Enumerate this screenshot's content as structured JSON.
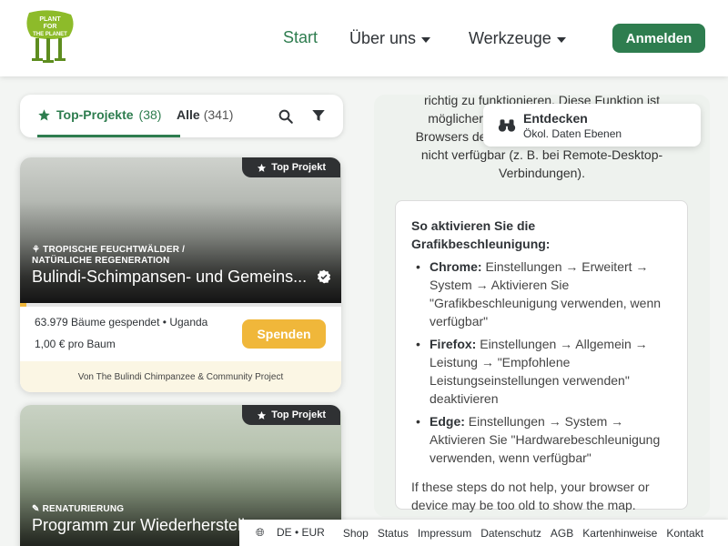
{
  "header": {
    "logo_alt": "PLANT FOR THE PLANET",
    "nav": {
      "start": "Start",
      "about": "Über uns",
      "tools": "Werkzeuge"
    },
    "login_label": "Anmelden",
    "accent": "#2e7d4f"
  },
  "tabs": {
    "top_label": "Top-Projekte",
    "top_count": "(38)",
    "all_label": "Alle",
    "all_count": "(341)"
  },
  "projects": [
    {
      "badge": "Top Projekt",
      "category": "Tropische Feuchtwälder / natürliche Regeneration",
      "title": "Bulindi-Schimpansen- und Gemeins...",
      "stats": "63.979 Bäume gespendet • Uganda",
      "price": "1,00 € pro Baum",
      "donate_label": "Spenden",
      "by": "Von The Bulindi Chimpanzee & Community Project",
      "progress_percent": 2
    },
    {
      "badge": "Top Projekt",
      "category": "Renaturierung",
      "title": "Programm zur Wiederherstellung"
    }
  ],
  "map": {
    "intro_text": "richtig zu funktionieren. Diese Funktion ist möglicherweise deaktiviert oder in Ihrem Browsers deaktiviert oder in Ihrer Umgebung nicht verfügbar (z. B. bei Remote-Desktop-Verbindungen).",
    "explore_title": "Entdecken",
    "explore_sub": "Ökol. Daten Ebenen",
    "instructions": {
      "title": "So aktivieren Sie die Grafikbeschleunigung:",
      "items": [
        {
          "browser": "Chrome:",
          "text": " Einstellungen → Erweitert → System → Aktivieren Sie \"Grafikbeschleunigung verwenden, wenn verfügbar\""
        },
        {
          "browser": "Firefox:",
          "text": " Einstellungen → Allgemein → Leistung → \"Empfohlene Leistungseinstellungen verwenden\" deaktivieren"
        },
        {
          "browser": "Edge:",
          "text": " Einstellungen → System → Aktivieren Sie \"Hardwarebeschleunigung verwenden, wenn verfügbar\""
        }
      ],
      "footer": "If these steps do not help, your browser or device may be too old to show the map."
    }
  },
  "footer": {
    "lang": "DE • EUR",
    "links": [
      "Shop",
      "Status",
      "Impressum",
      "Datenschutz",
      "AGB",
      "Kartenhinweise",
      "Kontakt"
    ]
  }
}
